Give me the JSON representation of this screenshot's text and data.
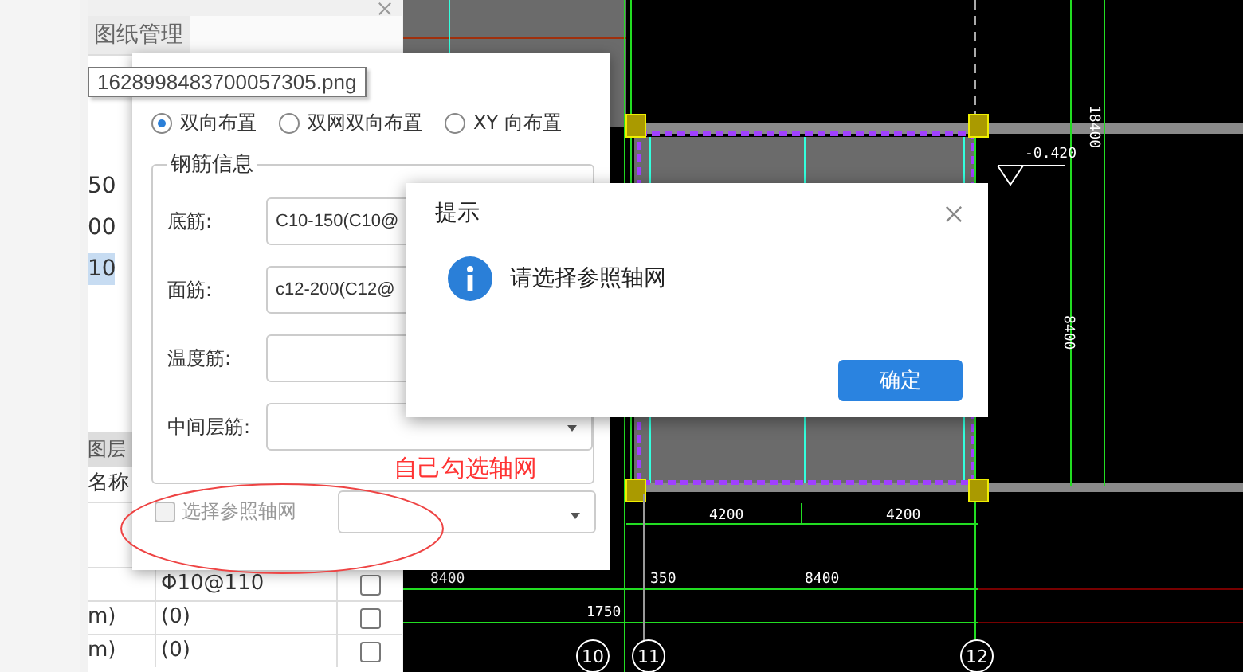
{
  "left_panel": {
    "tabs": [
      {
        "label": "图纸管理",
        "selected": true
      }
    ],
    "list_items": [
      {
        "text": "50",
        "selected": false
      },
      {
        "text": "00",
        "selected": false
      },
      {
        "text": "10",
        "selected": true
      }
    ],
    "layer_panel": {
      "title": "图层",
      "column": "名称",
      "rows": [
        {
          "name": "",
          "value": "Φ10@110",
          "checked": false
        },
        {
          "name": "m)",
          "value": "(0)",
          "checked": false
        },
        {
          "name": "m)",
          "value": "(0)",
          "checked": false
        }
      ]
    }
  },
  "tooltip": "1628998483700057305.png",
  "rebar_dialog": {
    "layout_options": [
      {
        "label": "双向布置",
        "selected": true
      },
      {
        "label": "双网双向布置",
        "selected": false
      },
      {
        "label": "XY 向布置",
        "selected": false
      }
    ],
    "group_title": "钢筋信息",
    "fields": [
      {
        "kind": "text",
        "label": "底筋:",
        "value": "C10-150(C10@"
      },
      {
        "kind": "text",
        "label": "面筋:",
        "value": "c12-200(C12@"
      },
      {
        "kind": "text",
        "label": "温度筋:"
      },
      {
        "kind": "select",
        "label": "中间层筋:"
      }
    ],
    "grid_checkbox": {
      "label": "选择参照轴网",
      "checked": false,
      "disabled": true
    }
  },
  "annotation": "自己勾选轴网",
  "alert": {
    "title": "提示",
    "message": "请选择参照轴网",
    "button": "确定"
  },
  "cad": {
    "labels": [
      "-0.420",
      "18400",
      "8400",
      "4200",
      "4200",
      "8400",
      "350",
      "8400",
      "1750"
    ],
    "axes": [
      "10",
      "11",
      "12"
    ]
  }
}
